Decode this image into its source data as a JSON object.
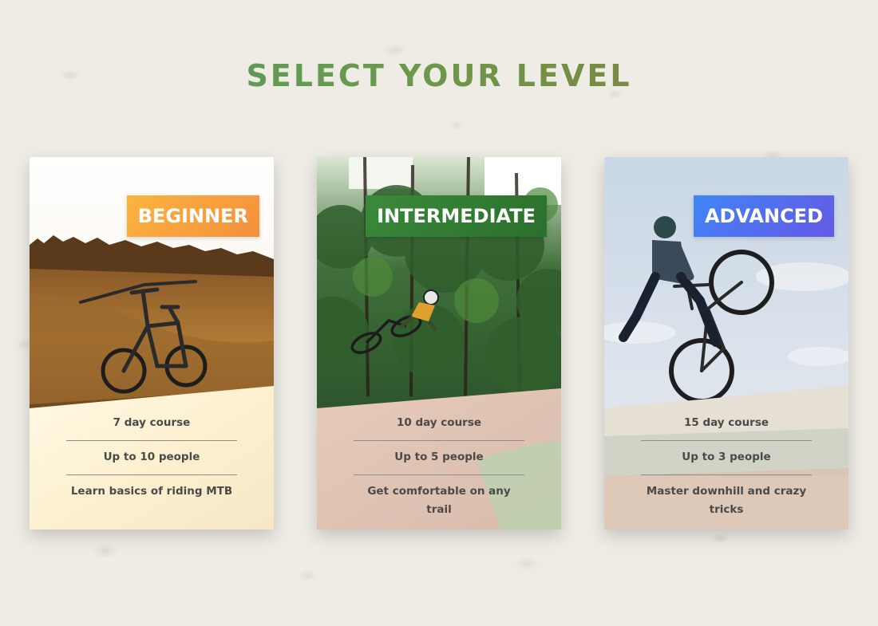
{
  "page": {
    "title": "SELECT YOUR LEVEL"
  },
  "cards": [
    {
      "level": "BEGINNER",
      "accent": "#f9a23e",
      "photo": "mountain-bike-on-hill-at-sunset",
      "details": [
        "7 day course",
        "Up to 10 people",
        "Learn basics of riding MTB"
      ]
    },
    {
      "level": "INTERMEDIATE",
      "accent": "#317c34",
      "photo": "rider-jumping-in-forest",
      "details": [
        "10 day course",
        "Up to 5 people",
        "Get comfortable on any trail"
      ]
    },
    {
      "level": "ADVANCED",
      "accent": "#5470ee",
      "photo": "bmx-rider-trick-in-sky",
      "details": [
        "15 day course",
        "Up to 3 people",
        "Master downhill and crazy tricks"
      ]
    }
  ]
}
